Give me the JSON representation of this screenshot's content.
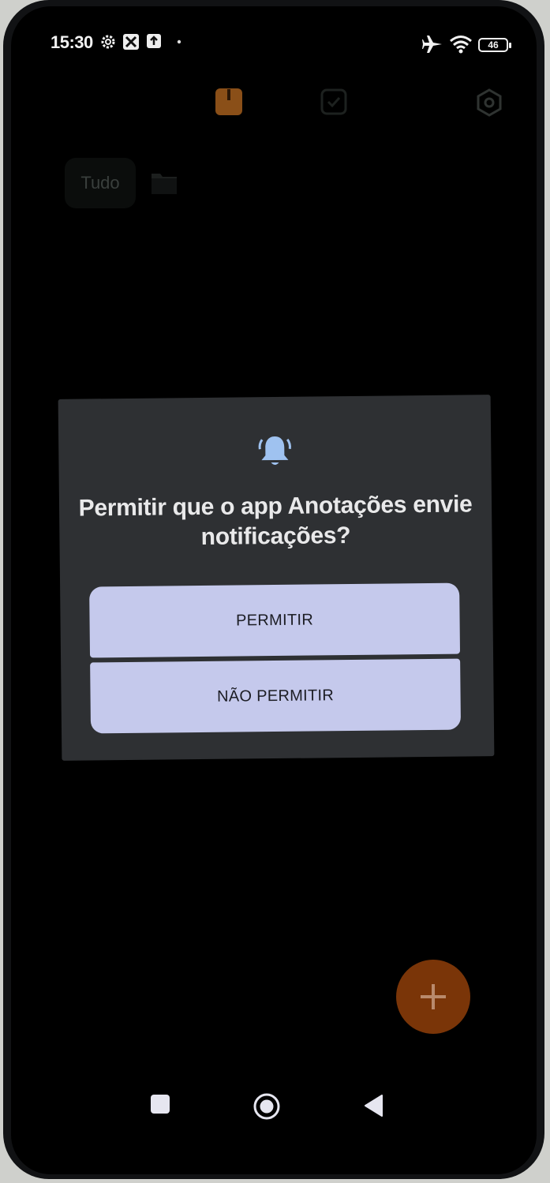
{
  "status_bar": {
    "time": "15:30",
    "battery_level": "46",
    "icons": [
      "settings-gear-icon",
      "app-notification-icon",
      "upload-icon",
      "dot-icon",
      "airplane-icon",
      "wifi-icon",
      "battery-icon"
    ]
  },
  "app_bar": {
    "icons": [
      "notes-icon",
      "tasks-icon",
      "settings-icon"
    ],
    "accent": "#e07b1a"
  },
  "filters": {
    "all_label": "Tudo",
    "folder_icon": "folder-icon"
  },
  "dialog": {
    "icon": "bell-icon",
    "title": "Permitir que o app Anotações envie notificações?",
    "allow_label": "PERMITIR",
    "deny_label": "NÃO PERMITIR",
    "button_color": "#c5c9ec",
    "background": "#2e3033"
  },
  "fab": {
    "icon": "plus-icon",
    "color": "#7a3508"
  },
  "nav_bar": {
    "icons": [
      "recents-icon",
      "home-icon",
      "back-icon"
    ]
  }
}
